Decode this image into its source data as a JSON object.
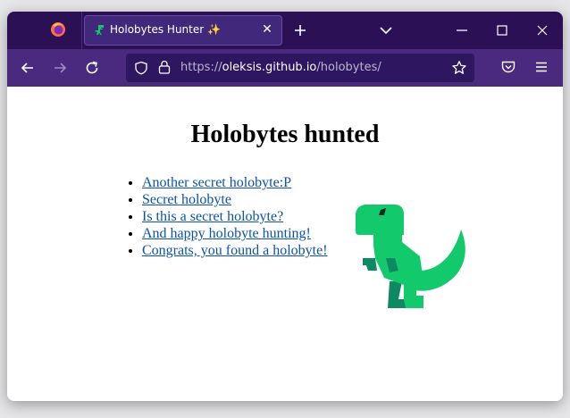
{
  "browser": {
    "tab": {
      "title": "Holobytes Hunter ✨",
      "close_glyph": "✕"
    },
    "url": {
      "scheme": "https://",
      "host": "oleksis.github.io",
      "path": "/holobytes/"
    },
    "icons": [
      "firefox-logo-icon",
      "dinosaur-favicon-icon",
      "close-icon",
      "plus-icon",
      "chevron-down-icon",
      "minimize-icon",
      "maximize-icon",
      "window-close-icon",
      "back-arrow-icon",
      "forward-arrow-icon",
      "reload-icon",
      "shield-icon",
      "lock-icon",
      "star-icon",
      "pocket-icon",
      "hamburger-menu-icon"
    ],
    "colors": {
      "tabstrip": "#2b1055",
      "toolbar": "#4a2a7e",
      "link": "#0b53a8",
      "dino_green": "#12c96c"
    }
  },
  "page": {
    "heading": "Holobytes hunted",
    "links": [
      {
        "label": "Another secret holobyte:P"
      },
      {
        "label": "Secret holobyte"
      },
      {
        "label": "Is this a secret holobyte?"
      },
      {
        "label": "And happy holobyte hunting!"
      },
      {
        "label": "Congrats, you found a holobyte!"
      }
    ]
  }
}
